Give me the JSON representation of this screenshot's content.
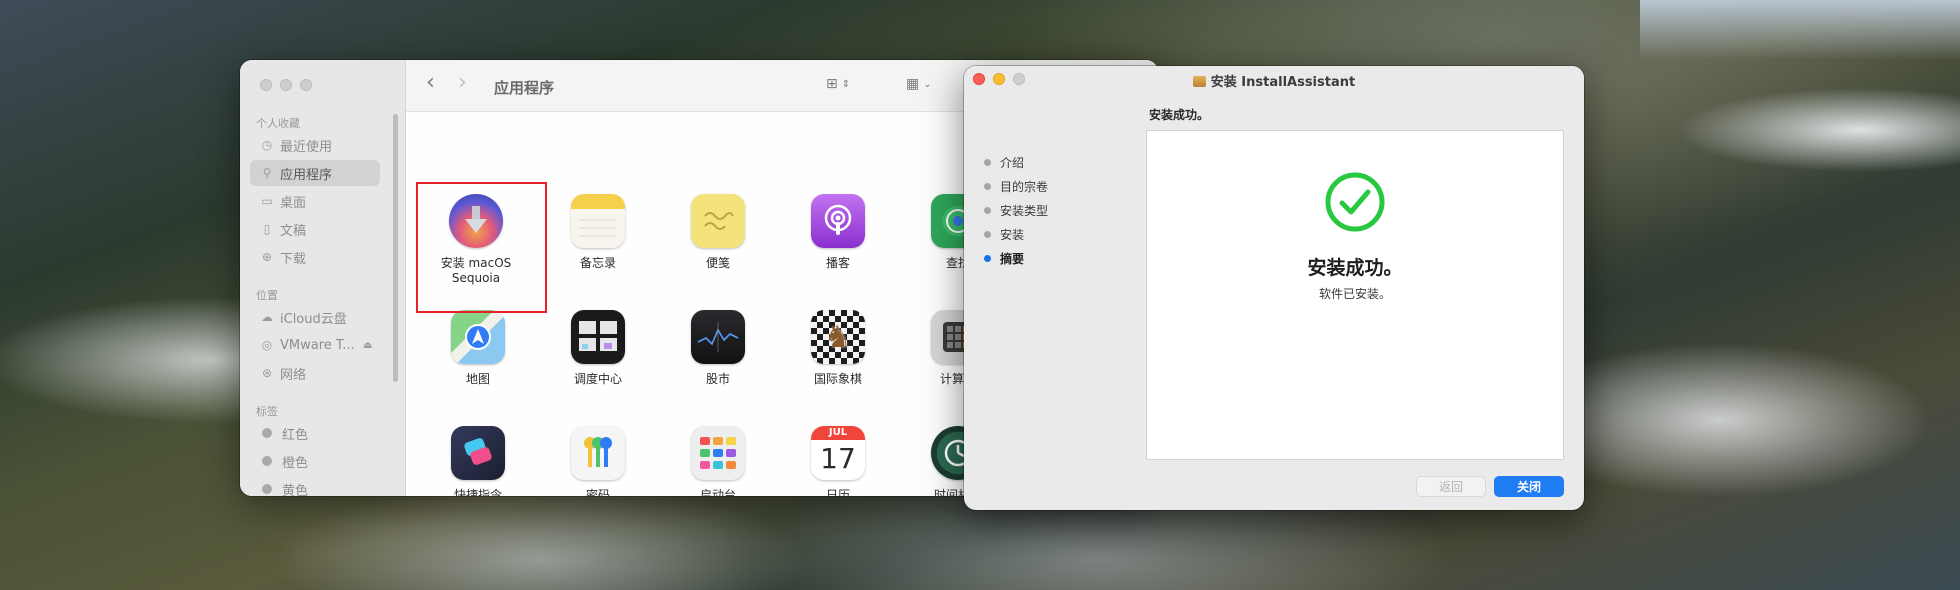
{
  "finder": {
    "title": "应用程序",
    "sidebar": {
      "favorites_header": "个人收藏",
      "favorites": [
        {
          "label": "最近使用",
          "icon": "clock-icon",
          "glyph": "◷"
        },
        {
          "label": "应用程序",
          "icon": "apps-icon",
          "glyph": "⚲"
        },
        {
          "label": "桌面",
          "icon": "desktop-icon",
          "glyph": "▭"
        },
        {
          "label": "文稿",
          "icon": "document-icon",
          "glyph": "▯"
        },
        {
          "label": "下载",
          "icon": "download-icon",
          "glyph": "⊕"
        }
      ],
      "locations_header": "位置",
      "locations": [
        {
          "label": "iCloud云盘",
          "icon": "cloud-icon",
          "glyph": "☁"
        },
        {
          "label": "VMware T...",
          "icon": "disk-icon",
          "glyph": "◎"
        },
        {
          "label": "网络",
          "icon": "network-icon",
          "glyph": "⊛"
        }
      ],
      "tags_header": "标签",
      "tags": [
        {
          "label": "红色"
        },
        {
          "label": "橙色"
        },
        {
          "label": "黄色"
        }
      ]
    },
    "apps": [
      {
        "label": "安装 macOS\nSequoia",
        "icon": "macos-installer-icon"
      },
      {
        "label": "备忘录",
        "icon": "notes-icon"
      },
      {
        "label": "便笺",
        "icon": "stickies-icon"
      },
      {
        "label": "播客",
        "icon": "podcasts-icon"
      },
      {
        "label": "查找",
        "icon": "findmy-icon"
      },
      {
        "label": "地图",
        "icon": "maps-icon"
      },
      {
        "label": "调度中心",
        "icon": "mission-control-icon"
      },
      {
        "label": "股市",
        "icon": "stocks-icon"
      },
      {
        "label": "国际象棋",
        "icon": "chess-icon"
      },
      {
        "label": "计算器",
        "icon": "calculator-icon"
      },
      {
        "label": "快捷指令",
        "icon": "shortcuts-icon"
      },
      {
        "label": "密码",
        "icon": "passwords-icon"
      },
      {
        "label": "启动台",
        "icon": "launchpad-icon"
      },
      {
        "label": "日历",
        "icon": "calendar-icon"
      },
      {
        "label": "时间机器",
        "icon": "time-machine-icon"
      }
    ],
    "calendar_month": "JUL",
    "calendar_day": "17"
  },
  "installer": {
    "title": "安装 InstallAssistant",
    "heading": "安装成功。",
    "steps": [
      {
        "label": "介绍",
        "current": false
      },
      {
        "label": "目的宗卷",
        "current": false
      },
      {
        "label": "安装类型",
        "current": false
      },
      {
        "label": "安装",
        "current": false
      },
      {
        "label": "摘要",
        "current": true
      }
    ],
    "success_title": "安装成功。",
    "success_subtitle": "软件已安装。",
    "back_label": "返回",
    "close_label": "关闭",
    "accent_color": "#1f7cf3",
    "success_color": "#28c840"
  }
}
